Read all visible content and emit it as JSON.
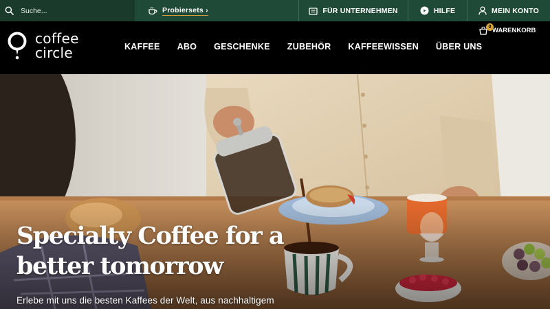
{
  "topbar": {
    "search_placeholder": "Suche...",
    "promo_label": "Probiersets ›",
    "b2b_label": "FÜR UNTERNEHMEN",
    "help_label": "HILFE",
    "account_label": "MEIN KONTO",
    "icons": [
      "search-icon",
      "coffee-cup-icon",
      "building-icon",
      "help-icon",
      "user-icon"
    ]
  },
  "header": {
    "logo_line1": "coffee",
    "logo_line2": "circle",
    "nav": [
      "KAFFEE",
      "ABO",
      "GESCHENKE",
      "ZUBEHÖR",
      "KAFFEEWISSEN",
      "ÜBER UNS"
    ],
    "cart_label": "WARENKORB",
    "cart_count": "0"
  },
  "hero": {
    "title_line1": "Specialty Coffee for a",
    "title_line2": "better tomorrow",
    "subtitle": "Erlebe mit uns die besten Kaffees der Welt, aus nachhaltigem"
  },
  "colors": {
    "topbar_bg": "#204a38",
    "header_bg": "#000000",
    "accent": "#d6a33b"
  }
}
